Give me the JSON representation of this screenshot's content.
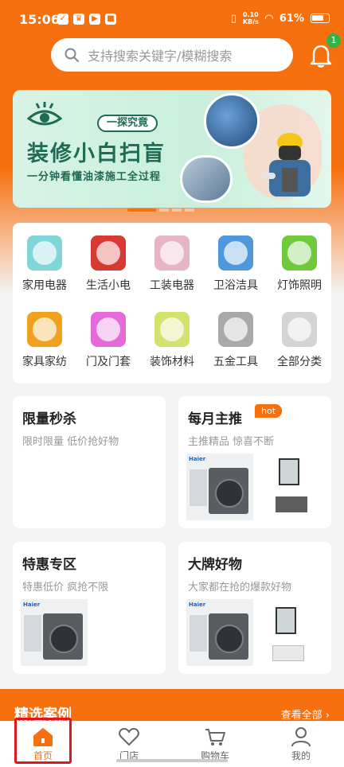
{
  "status_bar": {
    "time": "15:06",
    "net_speed": "0.10",
    "net_unit": "KB/s",
    "battery": "61%"
  },
  "search": {
    "placeholder": "支持搜索关键字/模糊搜索"
  },
  "notifications": {
    "badge_count": "1"
  },
  "banner": {
    "tag": "一探究竟",
    "title": "装修小白扫盲",
    "subtitle": "一分钟看懂油漆施工全过程",
    "slide_count": 4,
    "active_slide": 1
  },
  "categories": [
    {
      "label": "家用电器",
      "icon": "appliance-icon",
      "color": "#7fd6d9"
    },
    {
      "label": "生活小电",
      "icon": "small-appliance-icon",
      "color": "#d63a32"
    },
    {
      "label": "工装电器",
      "icon": "commercial-appliance-icon",
      "color": "#e7b3c7"
    },
    {
      "label": "卫浴洁具",
      "icon": "bathroom-icon",
      "color": "#4f98de"
    },
    {
      "label": "灯饰照明",
      "icon": "lighting-icon",
      "color": "#6fca3c"
    },
    {
      "label": "家具家纺",
      "icon": "furniture-icon",
      "color": "#f0a21f"
    },
    {
      "label": "门及门套",
      "icon": "door-icon",
      "color": "#e46ad9"
    },
    {
      "label": "装饰材料",
      "icon": "decor-icon",
      "color": "#d3e26d"
    },
    {
      "label": "五金工具",
      "icon": "hardware-icon",
      "color": "#a9a9a9"
    },
    {
      "label": "全部分类",
      "icon": "all-categories-icon",
      "color": "#d4d4d4"
    }
  ],
  "promos": [
    {
      "title": "限量秒杀",
      "subtitle": "限时限量 低价抢好物"
    },
    {
      "title": "每月主推",
      "subtitle": "主推精品 惊喜不断",
      "badge": "hot"
    },
    {
      "title": "特惠专区",
      "subtitle": "特惠低价 疯抢不限"
    },
    {
      "title": "大牌好物",
      "subtitle": "大家都在抢的爆款好物"
    }
  ],
  "product_brand": "Haier",
  "section": {
    "title": "精选案例",
    "more": "查看全部"
  },
  "tabbar": [
    {
      "label": "首页",
      "icon": "home-icon",
      "active": true
    },
    {
      "label": "门店",
      "icon": "store-heart-icon",
      "active": false
    },
    {
      "label": "购物车",
      "icon": "cart-icon",
      "active": false
    },
    {
      "label": "我的",
      "icon": "profile-icon",
      "active": false
    }
  ],
  "colors": {
    "brand": "#f7700f",
    "banner_text": "#1f6b55",
    "badge_green": "#34b24c",
    "highlight": "#e0161d"
  }
}
